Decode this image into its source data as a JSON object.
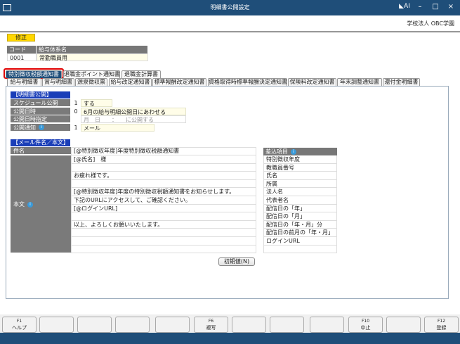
{
  "window": {
    "title": "明細書公開設定",
    "org": "学校法人 OBC学園"
  },
  "mode": "修正",
  "code_table": {
    "headers": [
      "コード",
      "給与体系名"
    ],
    "code": "0001",
    "name": "常勤職員用"
  },
  "tabs_row1": [
    {
      "label": "特別徴収税額通知書",
      "active": true
    },
    {
      "label": "退職金ポイント通知書"
    },
    {
      "label": "退職金計算書"
    }
  ],
  "tabs_row2": [
    "給与明細書",
    "賞与明細書",
    "源泉徴収票",
    "給与改定通知書",
    "標準報酬改定通知書",
    "資格取得時標準報酬決定通知書",
    "保険料改定通知書",
    "年末調整通知書",
    "還付金明細書"
  ],
  "publish": {
    "section": "【明細書公開】",
    "rows": [
      {
        "label": "スケジュール公開",
        "num": "1",
        "value": "する"
      },
      {
        "label": "公開日時",
        "num": "0",
        "value": "6月の給与明細公開日にあわせる"
      },
      {
        "label": "公開日時指定",
        "num": "",
        "value": "月　日　　：　　に公開する"
      },
      {
        "label": "公開通知",
        "num": "1",
        "value": "メール",
        "info": true
      }
    ]
  },
  "mail": {
    "section": "【メール件名／本文】",
    "subject_label": "件名",
    "subject": "[@特別徴収年度]年度特別徴収税額通知書",
    "body_label": "本文",
    "body": [
      "[@氏名]　様",
      "",
      "お疲れ様です。",
      "",
      "[@特別徴収年度]年度の特別徴収税額通知書をお知らせします。",
      "下記のURLにアクセスして、ご確認ください。",
      "[@ログインURL]",
      "",
      "以上、よろしくお願いいたします。",
      "",
      "",
      ""
    ],
    "insert_header": "差込項目",
    "insert_items": [
      "特別徴収年度",
      "教職員番号",
      "氏名",
      "所属",
      "法人名",
      "代表者名",
      "配信日の「年」",
      "配信日の「月」",
      "配信日の「年・月」分",
      "配信日の前月の「年・月」",
      "ログインURL",
      ""
    ],
    "reset_button": "初期値(N)"
  },
  "fkeys": [
    {
      "key": "F1",
      "label": "ヘルプ"
    },
    {
      "key": "",
      "label": ""
    },
    {
      "key": "",
      "label": ""
    },
    {
      "key": "",
      "label": ""
    },
    {
      "key": "",
      "label": ""
    },
    {
      "key": "F6",
      "label": "複写"
    },
    {
      "key": "",
      "label": ""
    },
    {
      "key": "",
      "label": ""
    },
    {
      "key": "",
      "label": ""
    },
    {
      "key": "F10",
      "label": "中止"
    },
    {
      "key": "",
      "label": ""
    },
    {
      "key": "F12",
      "label": "登録"
    }
  ],
  "colors": {
    "titlebar": "#1f4e79",
    "active_tab": "#1f4e79",
    "section": "#1a3eb8",
    "mode": "#ffd700",
    "highlight": "#e00000"
  }
}
